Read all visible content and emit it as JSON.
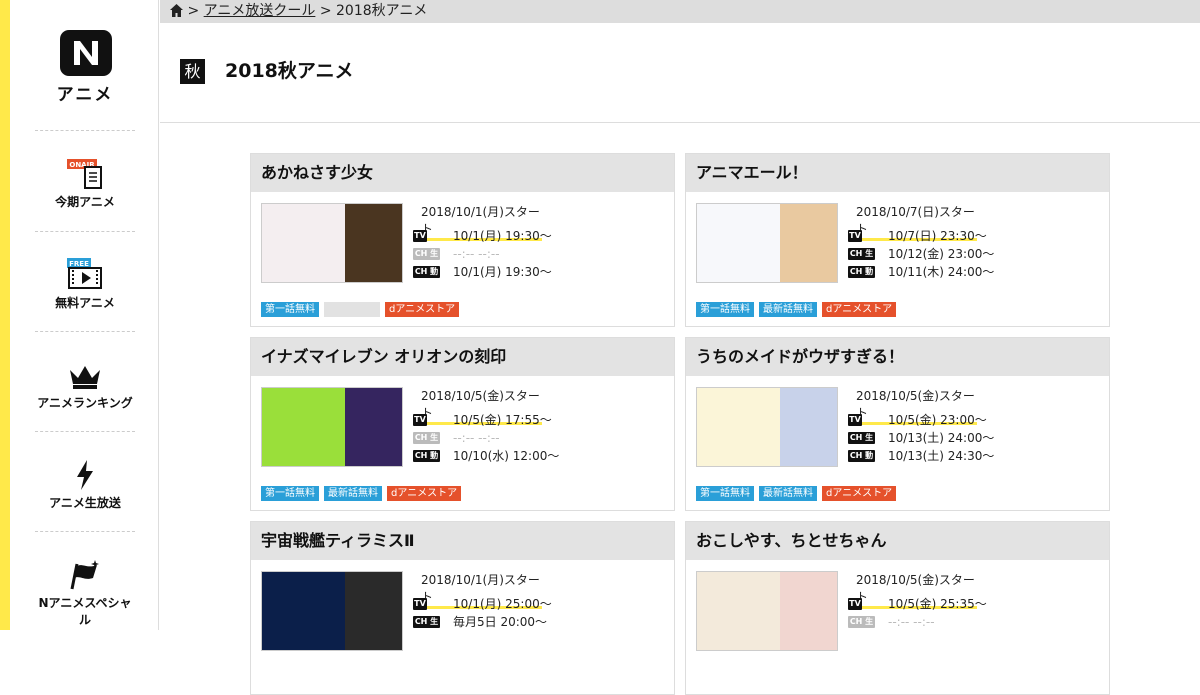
{
  "logo": {
    "mark": "N",
    "text": "アニメ"
  },
  "nav": [
    {
      "label": "今期アニメ",
      "icon": "onair-icon",
      "tag": "ONAIR"
    },
    {
      "label": "無料アニメ",
      "icon": "free-film-icon",
      "tag": "FREE"
    },
    {
      "label": "アニメランキング",
      "icon": "crown-icon"
    },
    {
      "label": "アニメ生放送",
      "icon": "lightning-icon"
    },
    {
      "label": "Nアニメスペシャル",
      "icon": "flag-icon"
    }
  ],
  "breadcrumb": {
    "sep1": ">",
    "link": "アニメ放送クール",
    "sep2": ">",
    "current": "2018秋アニメ"
  },
  "header": {
    "season_badge": "秋",
    "title": "2018秋アニメ"
  },
  "cards": [
    {
      "title": "あかねさす少女",
      "start": "2018/10/1(月)スタート",
      "tv": "10/1(月) 19:30～",
      "live": "--:-- --:--",
      "douga": "10/1(月) 19:30～",
      "live_disabled": true,
      "badges": [
        "第一話無料",
        "",
        "dアニメストア"
      ]
    },
    {
      "title": "アニマエール！",
      "start": "2018/10/7(日)スタート",
      "tv": "10/7(日) 23:30～",
      "live": "10/12(金) 23:00～",
      "douga": "10/11(木) 24:00～",
      "live_disabled": false,
      "badges": [
        "第一話無料",
        "最新話無料",
        "dアニメストア"
      ]
    },
    {
      "title": "イナズマイレブン オリオンの刻印",
      "start": "2018/10/5(金)スタート",
      "tv": "10/5(金) 17:55～",
      "live": "--:-- --:--",
      "douga": "10/10(水) 12:00～",
      "live_disabled": true,
      "badges": [
        "第一話無料",
        "最新話無料",
        "dアニメストア"
      ]
    },
    {
      "title": "うちのメイドがウザすぎる！",
      "start": "2018/10/5(金)スタート",
      "tv": "10/5(金) 23:00～",
      "live": "10/13(土) 24:00～",
      "douga": "10/13(土) 24:30～",
      "live_disabled": false,
      "badges": [
        "第一話無料",
        "最新話無料",
        "dアニメストア"
      ]
    },
    {
      "title": "宇宙戦艦ティラミスⅡ",
      "start": "2018/10/1(月)スタート",
      "tv": "10/1(月) 25:00～",
      "live": "毎月5日 20:00～",
      "douga": "",
      "live_disabled": false,
      "badges": []
    },
    {
      "title": "おこしやす、ちとせちゃん",
      "start": "2018/10/5(金)スタート",
      "tv": "10/5(金) 25:35～",
      "live": "--:-- --:--",
      "douga": "",
      "live_disabled": true,
      "badges": []
    }
  ],
  "labels": {
    "tv": "TV",
    "live": "CH 生",
    "douga": "CH 動"
  },
  "colors": {
    "accent_yellow": "#ffe94a",
    "badge_blue": "#2a9fd8",
    "badge_red": "#e5512b"
  }
}
